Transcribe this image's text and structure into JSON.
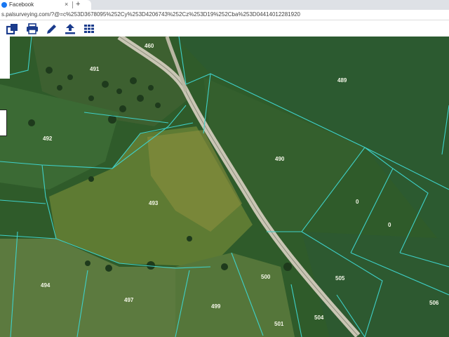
{
  "browser": {
    "tab_title": "Facebook",
    "tab_close": "×",
    "new_tab": "+",
    "url": "s.palsurveying.com/?@=c%253D3678095%252Cy%253D4206743%252Cz%253D19%252Cba%253D04414012281920"
  },
  "toolbar": {
    "tools": [
      "copy-layers-icon",
      "print-icon",
      "pencil-icon",
      "upload-icon",
      "grid-icon"
    ],
    "icon_color": "#1a3b8c"
  },
  "map": {
    "parcel_line_color": "#3fd0c8",
    "parcels": {
      "p460": "460",
      "p491": "491",
      "p489": "489",
      "p492": "492",
      "p490": "490",
      "p493": "493",
      "p0a": "0",
      "p0b": "0",
      "p494": "494",
      "p497": "497",
      "p500": "500",
      "p505": "505",
      "p499": "499",
      "p501": "501",
      "p504": "504",
      "p506": "506"
    }
  }
}
